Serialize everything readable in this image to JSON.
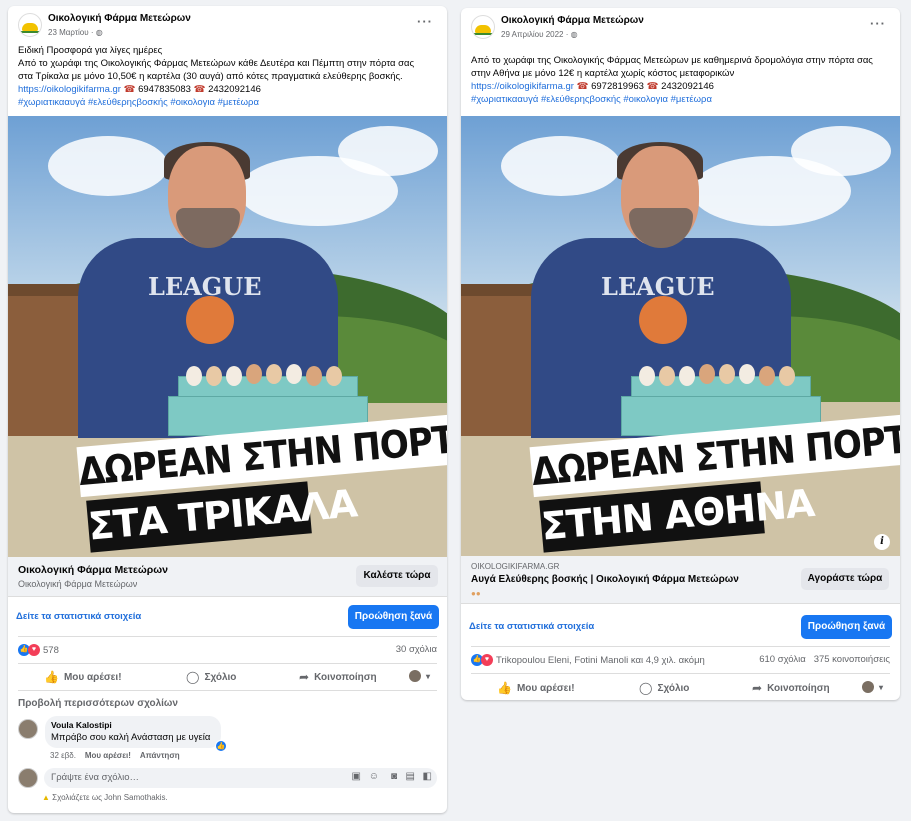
{
  "post1": {
    "page_name": "Οικολογική Φάρμα Μετεώρων",
    "date": "23 Μαρτίου · ",
    "lines": [
      "Ειδική Προσφορά για λίγες ημέρες",
      "Από το χωράφι της Οικολογικής Φάρμας Μετεώρων κάθε Δευτέρα και Πέμπτη στην πόρτα σας",
      "στα Τρίκαλα με μόνο 10,50€ η καρτέλα (30 αυγά) από κότες πραγματικά ελεύθερης βοσκής."
    ],
    "link": "https://oikologikifarma.gr",
    "phone1": "6947835083",
    "phone2": "2432092146",
    "hashtags": "#χωριατικααυγά #ελεύθερηςβοσκής #οικολογια #μετέωρα",
    "banner1": "ΔΩΡΕΑΝ ΣΤΗΝ ΠΟΡΤΑ ΣΑΣ",
    "banner2": "ΣΤΑ ΤΡΙΚΑΛΑ",
    "cta_title": "Οικολογική Φάρμα Μετεώρων",
    "cta_sub": "Οικολογική Φάρμα Μετεώρων",
    "cta_button": "Καλέστε τώρα",
    "insights": "Δείτε τα στατιστικά στοιχεία",
    "boost": "Προώθηση ξανά",
    "reactions": "578",
    "comments_count": "30 σχόλια",
    "like": "Μου αρέσει!",
    "comment": "Σχόλιο",
    "share": "Κοινοποίηση",
    "more_comments": "Προβολή περισσότερων σχολίων",
    "commenter": "Voula Kalostipi",
    "comment_text": "Μπράβο σου καλή Ανάσταση με υγεία",
    "comment_age": "32 εβδ.",
    "comment_like": "Μου αρέσει!",
    "comment_reply": "Απάντηση",
    "composer_placeholder": "Γράψτε ένα σχόλιο…",
    "commenting_as": "Σχολιάζετε ως John Samothakis."
  },
  "post2": {
    "page_name": "Οικολογική Φάρμα Μετεώρων",
    "date": "29 Απριλίου 2022 · ",
    "lines": [
      "Από το χωράφι της Οικολογικής Φάρμας Μετεώρων  με καθημερινά δρομολόγια στην πόρτα σας",
      "στην Αθήνα  με μόνο 12€ η καρτέλα χωρίς κόστος μεταφορικών"
    ],
    "link": "https://oikologikifarma.gr",
    "phone1": "6972819963",
    "phone2": "2432092146",
    "hashtags": "#χωριατικααυγά #ελεύθερηςβοσκής #οικολογια #μετέωρα",
    "banner1": "ΔΩΡΕΑΝ ΣΤΗΝ ΠΟΡΤΑ ΣΑΣ",
    "banner2": "ΣΤΗΝ ΑΘΗΝΑ",
    "domain": "OIKOLOGIKIFARMA.GR",
    "cta_title": "Αυγά Ελεύθερης βοσκής | Οικολογική Φάρμα Μετεώρων",
    "cta_button": "Αγοράστε τώρα",
    "insights": "Δείτε τα στατιστικά στοιχεία",
    "boost": "Προώθηση ξανά",
    "reactions": "Trikopoulou Eleni, Fotini Manoli και 4,9 χιλ. ακόμη",
    "comments_count": "610 σχόλια",
    "shares_count": "375 κοινοποιήσεις",
    "like": "Μου αρέσει!",
    "comment": "Σχόλιο",
    "share": "Κοινοποίηση"
  },
  "colors": {
    "accent": "#1877f2",
    "link": "#216fdb",
    "brand_yellow": "#f2c200"
  }
}
